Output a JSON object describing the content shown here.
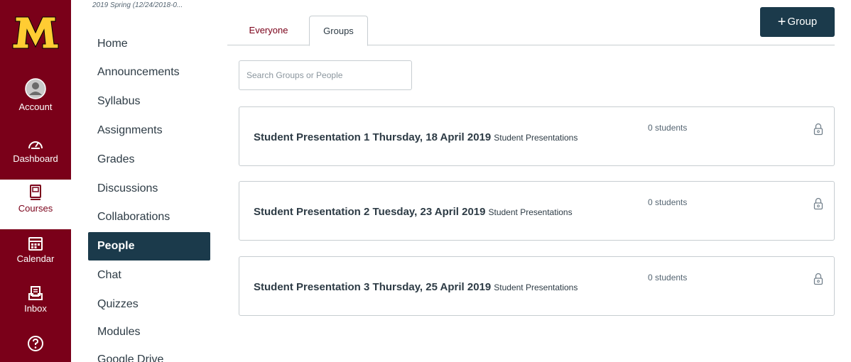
{
  "global_nav": {
    "logo_icon": "university-m-logo",
    "items": [
      {
        "label": "Account",
        "icon": "user-avatar-icon"
      },
      {
        "label": "Dashboard",
        "icon": "dashboard-gauge-icon"
      },
      {
        "label": "Courses",
        "icon": "book-icon"
      },
      {
        "label": "Calendar",
        "icon": "calendar-icon"
      },
      {
        "label": "Inbox",
        "icon": "inbox-icon"
      },
      {
        "label": "",
        "icon": "help-icon"
      }
    ],
    "active": "Courses",
    "brand_color": "#7a0019"
  },
  "course_nav": {
    "term": "2019 Spring (12/24/2018-0...",
    "items": [
      {
        "label": "Home"
      },
      {
        "label": "Announcements"
      },
      {
        "label": "Syllabus"
      },
      {
        "label": "Assignments"
      },
      {
        "label": "Grades"
      },
      {
        "label": "Discussions"
      },
      {
        "label": "Collaborations"
      },
      {
        "label": "People"
      },
      {
        "label": "Chat"
      },
      {
        "label": "Quizzes"
      },
      {
        "label": "Modules"
      },
      {
        "label": "Google Drive"
      }
    ],
    "active": "People",
    "active_color": "#1b3a4b"
  },
  "main": {
    "tabs": [
      {
        "label": "Everyone"
      },
      {
        "label": "Groups"
      }
    ],
    "active_tab": "Groups",
    "add_group_label": "Group",
    "search_placeholder": "Search Groups or People",
    "groups": [
      {
        "title": "Student Presentation 1 Thursday, 18 April 2019",
        "category": "Student Presentations",
        "count": "0 students",
        "icon": "lock-icon"
      },
      {
        "title": "Student Presentation 2 Tuesday, 23 April 2019",
        "category": "Student Presentations",
        "count": "0 students",
        "icon": "lock-icon"
      },
      {
        "title": "Student Presentation 3 Thursday, 25 April 2019",
        "category": "Student Presentations",
        "count": "0 students",
        "icon": "lock-icon"
      }
    ]
  }
}
